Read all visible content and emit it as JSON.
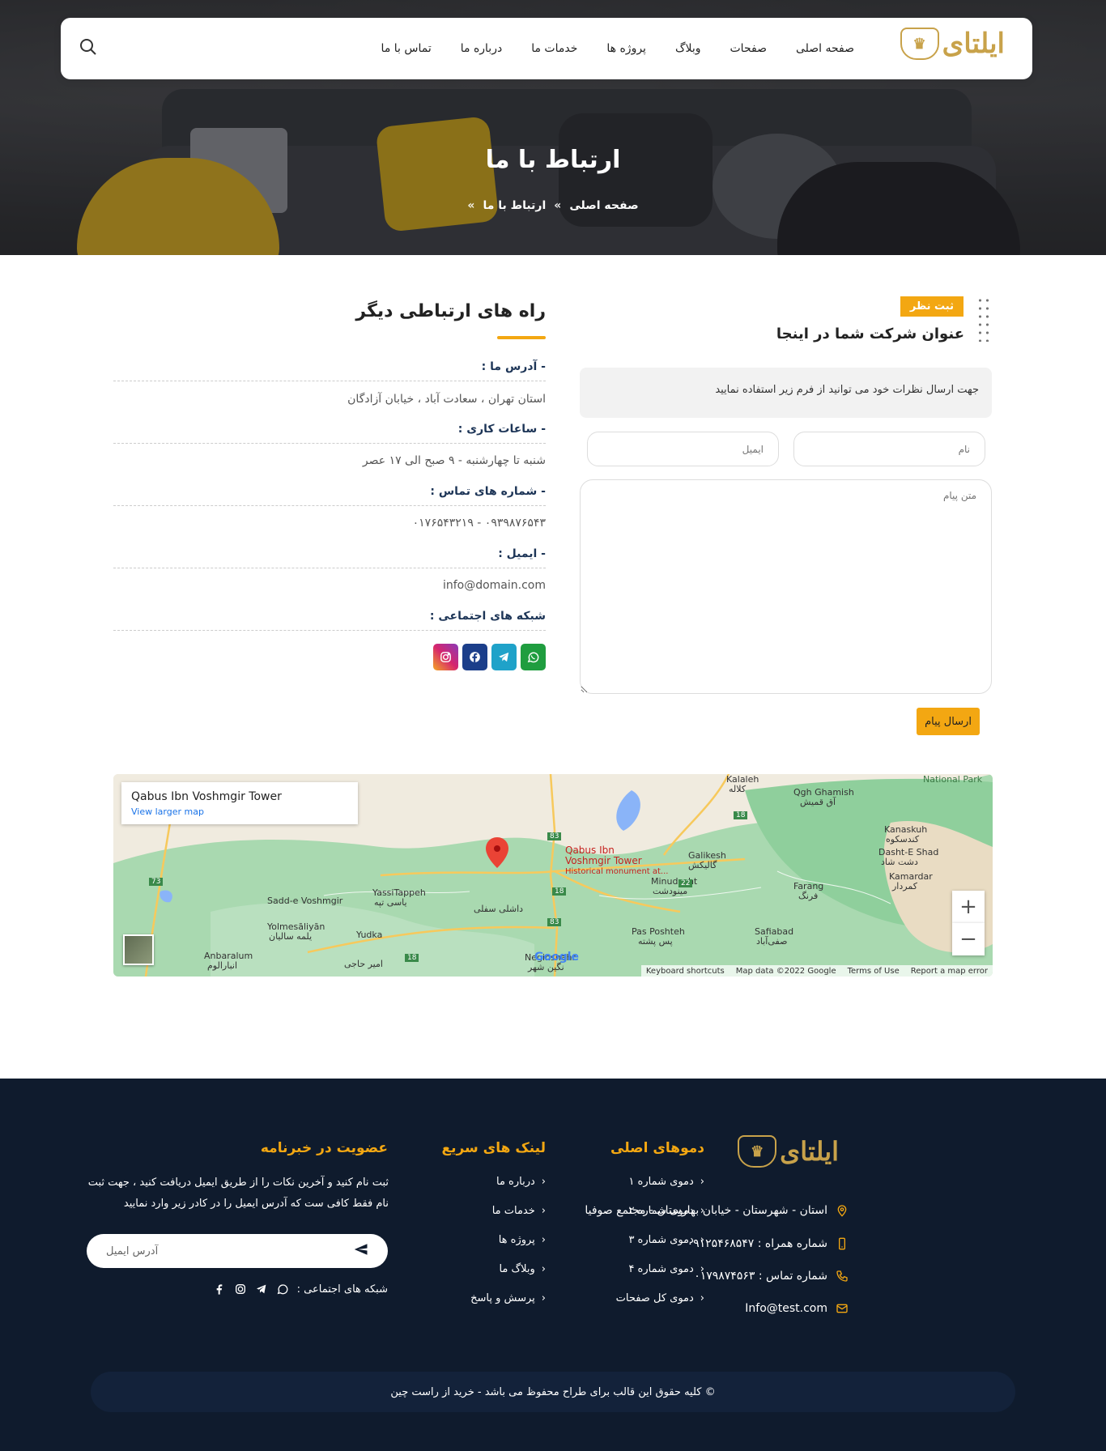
{
  "brand": {
    "logo_text": "ایلتای"
  },
  "nav": {
    "items": [
      "صفحه اصلی",
      "صفحات",
      "وبلاگ",
      "پروژه ها",
      "خدمات ما",
      "درباره ما",
      "تماس با ما"
    ]
  },
  "hero": {
    "title": "ارتباط با ما",
    "breadcrumb": {
      "home": "صفحه اصلی",
      "current": "ارتباط با ما",
      "sep": "»"
    }
  },
  "form": {
    "tag": "ثبت نظر",
    "heading": "عنوان شرکت شما در اینجا",
    "note": "جهت ارسال نظرات خود می توانید از فرم زیر استفاده نمایید",
    "name_placeholder": "نام",
    "email_placeholder": "ایمیل",
    "message_placeholder": "متن پیام",
    "submit_label": "ارسال پیام"
  },
  "contact": {
    "title": "راه های ارتباطی دیگر",
    "address_label": "- آدرس ما :",
    "address_value": "استان تهران ، سعادت آباد ، خیابان آزادگان",
    "hours_label": "- ساعات کاری :",
    "hours_value": "شنبه تا چهارشنبه - ۹ صبح الی ۱۷ عصر",
    "phones_label": "- شماره های تماس :",
    "phones_value": "۰۹۳۹۸۷۶۵۴۳ - ۰۱۷۶۵۴۳۲۱۹",
    "email_label": "- ایمیل :",
    "email_value": "info@domain.com",
    "social_label": "شبکه های اجتماعی :",
    "social": [
      {
        "icon": "whatsapp-icon",
        "color": "#1f9d3f"
      },
      {
        "icon": "telegram-icon",
        "color": "#1fa2c9"
      },
      {
        "icon": "facebook-icon",
        "color": "#1b3e8a"
      },
      {
        "icon": "instagram-icon",
        "color": "#d6266d"
      }
    ]
  },
  "map": {
    "place_title": "Qabus Ibn Voshmgir Tower",
    "larger_map": "View larger map",
    "pin_label_1": "Qabus Ibn",
    "pin_label_2": "Voshmgir Tower",
    "pin_label_3": "Historical monument at...",
    "labels": [
      "Kalaleh",
      "Qgh Ghamish",
      "Kanaskuh",
      "Dasht-E Shad",
      "Kamardar",
      "Galikesh",
      "Minudasht",
      "Farang",
      "Pas Poshteh",
      "Safiabad",
      "YassiTappeh",
      "Sadd-e Voshmgir",
      "Yolmesāliyān",
      "Yudka",
      "Anbaralum",
      "Neginshahr",
      "National Park"
    ],
    "labels_fa": [
      "کلاله",
      "آق قمیش",
      "کندسکوه",
      "دشت شاد",
      "کمردار",
      "گالیکش",
      "مینودشت",
      "فرنگ",
      "پس پشته",
      "صفی‌آباد",
      "یاسی تپه",
      "یلمه سالیان",
      "انبارالوم",
      "داشلی سفلی",
      "امیر حاجی",
      "نگین شهر"
    ],
    "roads": [
      "83",
      "18",
      "73",
      "22",
      "18",
      "83",
      "18"
    ],
    "footer": [
      "Keyboard shortcuts",
      "Map data ©2022 Google",
      "Terms of Use",
      "Report a map error"
    ],
    "google": "Google"
  },
  "footer": {
    "logo_text": "ایلتای",
    "address": "استان - شهرستان - خیابان بهارستان - مجتمع صوفیا",
    "mobile": "شماره همراه : ۰۹۱۲۵۴۶۸۵۴۷",
    "phone": "شماره تماس : ۰۱۷۹۸۷۴۵۶۳",
    "email": "Info@test.com",
    "demos_title": "دموهای اصلی",
    "demos": [
      "دموی شماره ۱",
      "دموی شماره ۲",
      "دموی شماره ۳",
      "دموی شماره ۴",
      "دموی کل صفحات"
    ],
    "links_title": "لینک های سریع",
    "links": [
      "درباره ما",
      "خدمات ما",
      "پروژه ها",
      "وبلاگ ما",
      "پرسش و پاسخ"
    ],
    "newsletter_title": "عضویت در خبرنامه",
    "newsletter_text": "ثبت نام کنید و آخرین نکات را از طریق ایمیل دریافت کنید ، جهت ثبت نام فقط کافی ست که آدرس ایمیل را در کادر زیر وارد نمایید",
    "newsletter_placeholder": "آدرس ایمیل",
    "social_label": "شبکه های اجتماعی :",
    "copyright": "© کلیه حقوق این قالب برای طراح محفوظ می باشد -  خرید از راست چین"
  },
  "colors": {
    "accent": "#f3a712",
    "footer_bg": "#0f1b2d",
    "label": "#1d3557"
  }
}
